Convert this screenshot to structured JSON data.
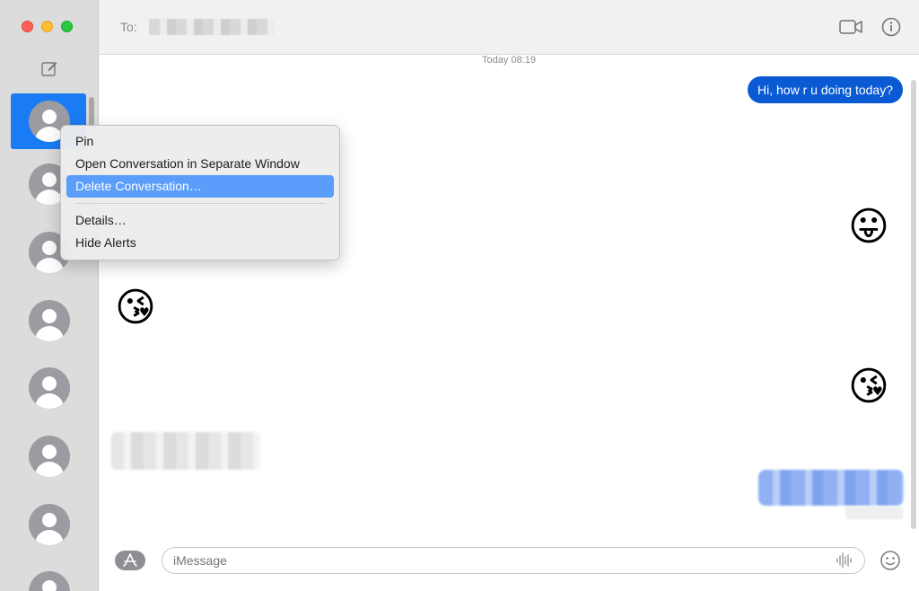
{
  "window": {
    "controls": [
      "close",
      "minimize",
      "zoom"
    ],
    "compose_icon": "compose-icon"
  },
  "header": {
    "to_label": "To:",
    "video_icon": "video-camera-icon",
    "info_icon": "info-icon"
  },
  "sidebar": {
    "conversations": [
      {
        "selected": true
      },
      {
        "selected": false
      },
      {
        "selected": false
      },
      {
        "selected": false
      },
      {
        "selected": false
      },
      {
        "selected": false
      },
      {
        "selected": false
      },
      {
        "selected": false
      }
    ]
  },
  "transcript": {
    "timestamp": "Today 08:19",
    "messages": [
      {
        "direction": "outgoing",
        "text": "Hi, how r u doing today?"
      },
      {
        "direction": "outgoing",
        "emoji": "😛"
      },
      {
        "direction": "incoming",
        "emoji": "😘"
      },
      {
        "direction": "outgoing",
        "emoji": "😘"
      }
    ]
  },
  "context_menu": {
    "items": [
      {
        "label": "Pin",
        "highlighted": false
      },
      {
        "label": "Open Conversation in Separate Window",
        "highlighted": false
      },
      {
        "label": "Delete Conversation…",
        "highlighted": true
      },
      {
        "label": "Details…",
        "highlighted": false
      },
      {
        "label": "Hide Alerts",
        "highlighted": false
      }
    ]
  },
  "composer": {
    "placeholder": "iMessage",
    "apps_icon": "app-store-icon",
    "audio_icon": "audio-waveform-icon",
    "emoji_icon": "emoji-picker-icon"
  },
  "colors": {
    "accent": "#0a5ad4",
    "selection": "#1a7cf5",
    "menu_highlight": "#5b9dfa"
  }
}
